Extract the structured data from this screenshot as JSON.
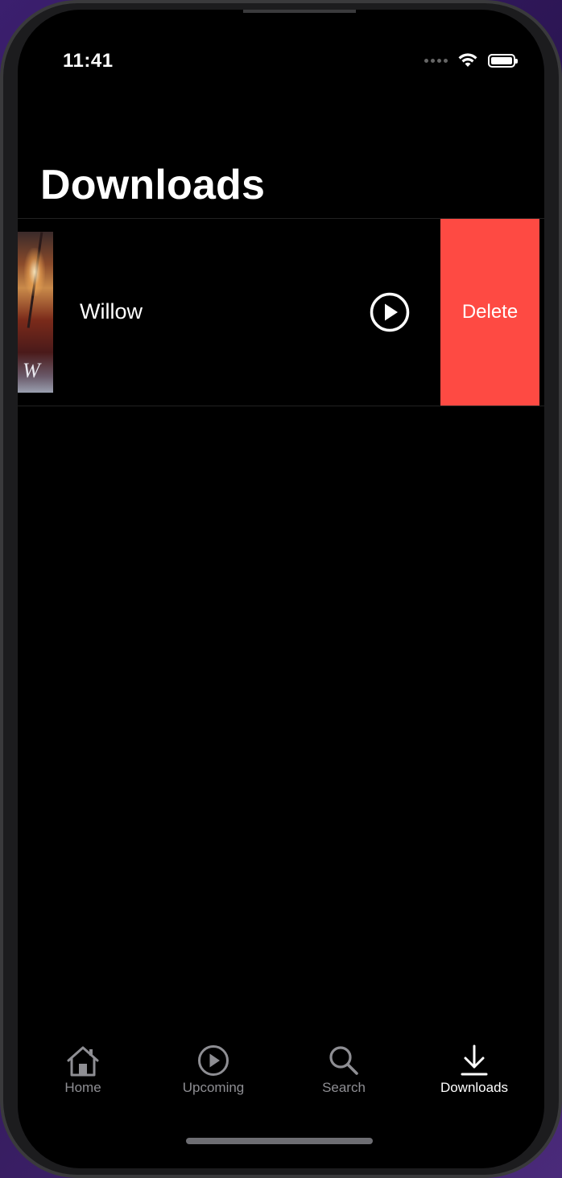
{
  "status_bar": {
    "time": "11:41"
  },
  "page": {
    "title": "Downloads"
  },
  "downloads": [
    {
      "title": "Willow",
      "poster_icon": "willow-poster-thumbnail",
      "play_icon": "play-circle-icon",
      "swipe_action": "Delete"
    }
  ],
  "tab_bar": {
    "tabs": [
      {
        "label": "Home",
        "icon": "house-icon",
        "active": false
      },
      {
        "label": "Upcoming",
        "icon": "play-circle-icon",
        "active": false
      },
      {
        "label": "Search",
        "icon": "magnifying-glass-icon",
        "active": false
      },
      {
        "label": "Downloads",
        "icon": "download-arrow-icon",
        "active": true
      }
    ]
  },
  "colors": {
    "background": "#000000",
    "delete_red": "#FE4A43",
    "tab_inactive": "#8E8E93",
    "tab_active": "#FFFFFF"
  }
}
